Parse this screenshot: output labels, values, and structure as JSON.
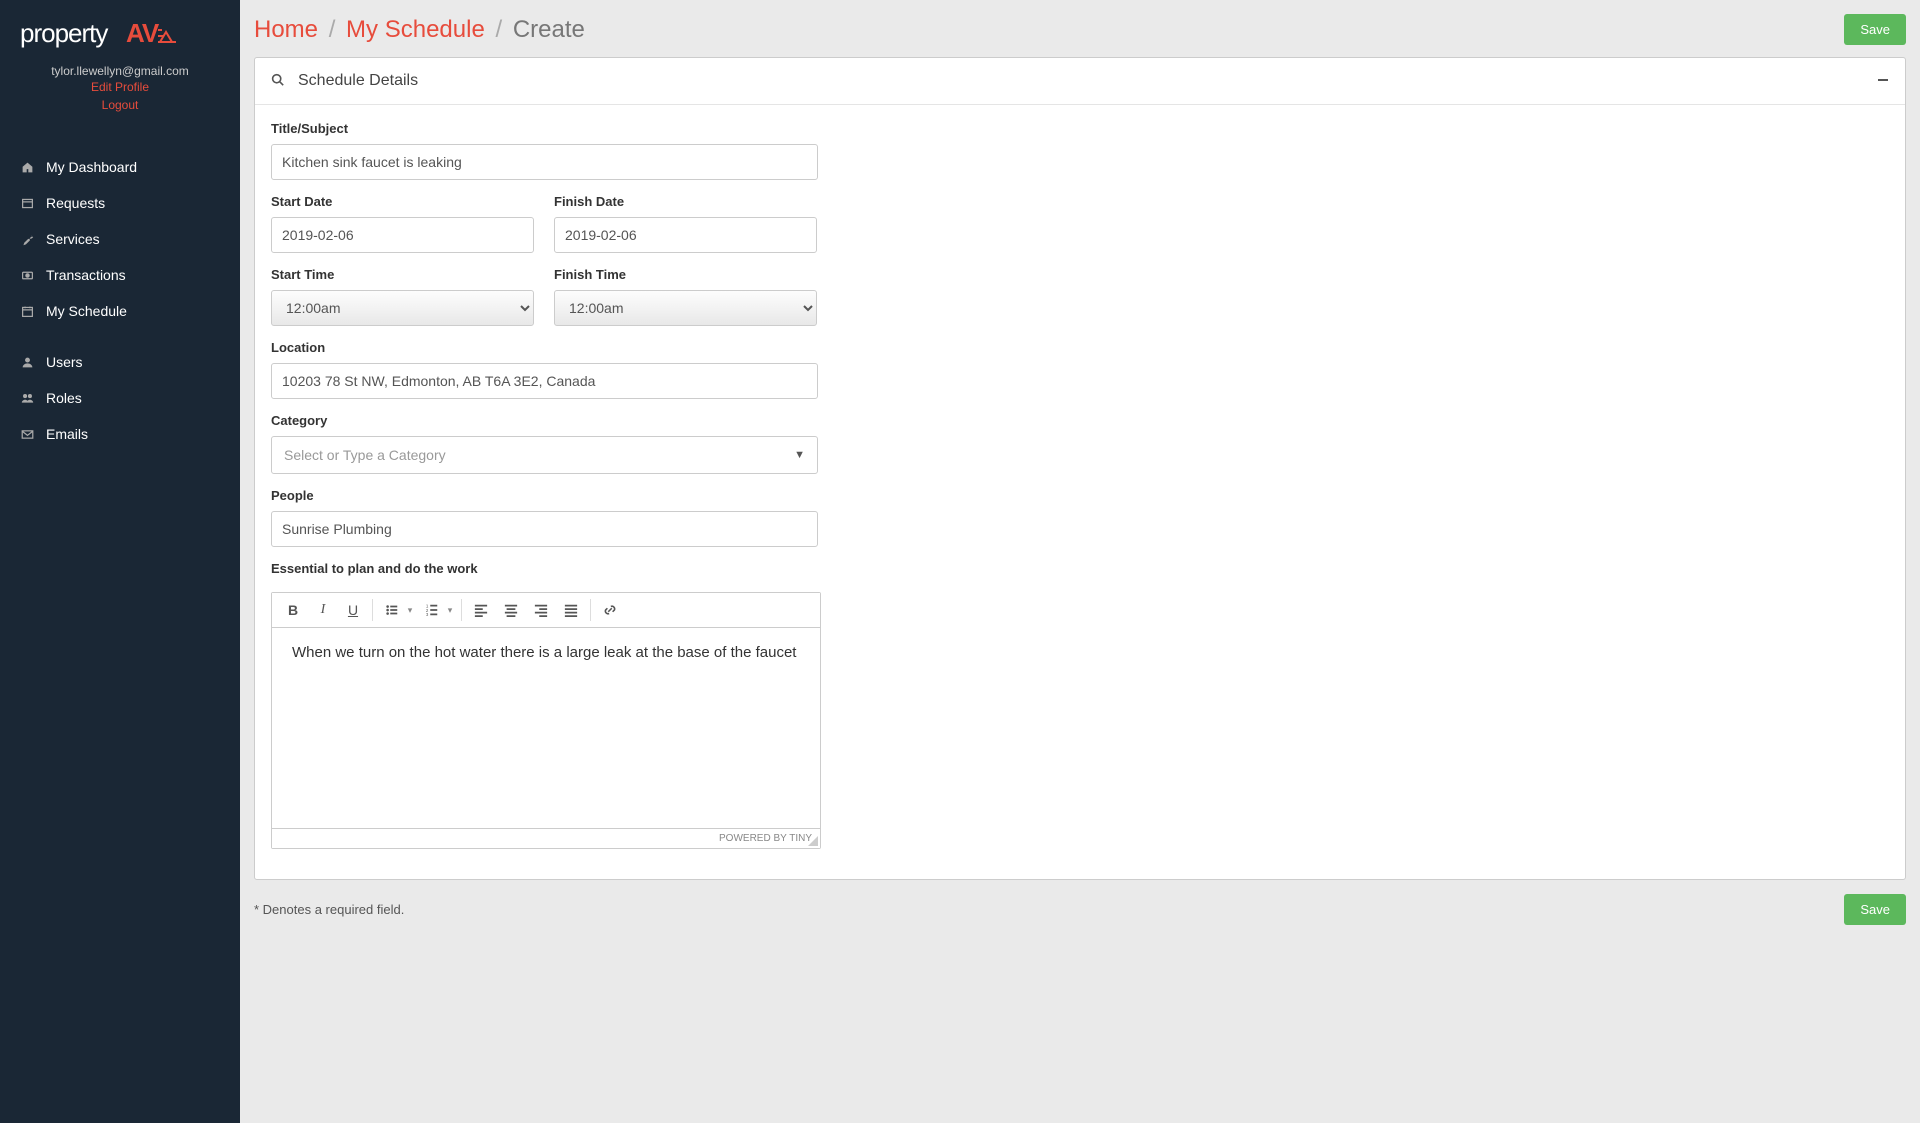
{
  "brand": {
    "part1": "property",
    "part2": "AV"
  },
  "user": {
    "email": "tylor.llewellyn@gmail.com",
    "edit_profile": "Edit Profile",
    "logout": "Logout"
  },
  "nav": {
    "dashboard": "My Dashboard",
    "requests": "Requests",
    "services": "Services",
    "transactions": "Transactions",
    "schedule": "My Schedule",
    "users": "Users",
    "roles": "Roles",
    "emails": "Emails"
  },
  "breadcrumb": {
    "home": "Home",
    "schedule": "My Schedule",
    "create": "Create"
  },
  "buttons": {
    "save": "Save"
  },
  "panel": {
    "title": "Schedule Details"
  },
  "form": {
    "title_label": "Title/Subject",
    "title_value": "Kitchen sink faucet is leaking",
    "start_date_label": "Start Date",
    "start_date_value": "2019-02-06",
    "finish_date_label": "Finish Date",
    "finish_date_value": "2019-02-06",
    "start_time_label": "Start Time",
    "start_time_value": "12:00am",
    "finish_time_label": "Finish Time",
    "finish_time_value": "12:00am",
    "location_label": "Location",
    "location_value": "10203 78 St NW, Edmonton, AB T6A 3E2, Canada",
    "category_label": "Category",
    "category_placeholder": "Select or Type a Category",
    "people_label": "People",
    "people_value": "Sunrise Plumbing",
    "detail_label": "Essential to plan and do the work",
    "detail_content": "When we turn on the hot water there is a large leak at the base of the faucet",
    "powered_by": "POWERED BY TINY"
  },
  "note": "* Denotes a required field."
}
